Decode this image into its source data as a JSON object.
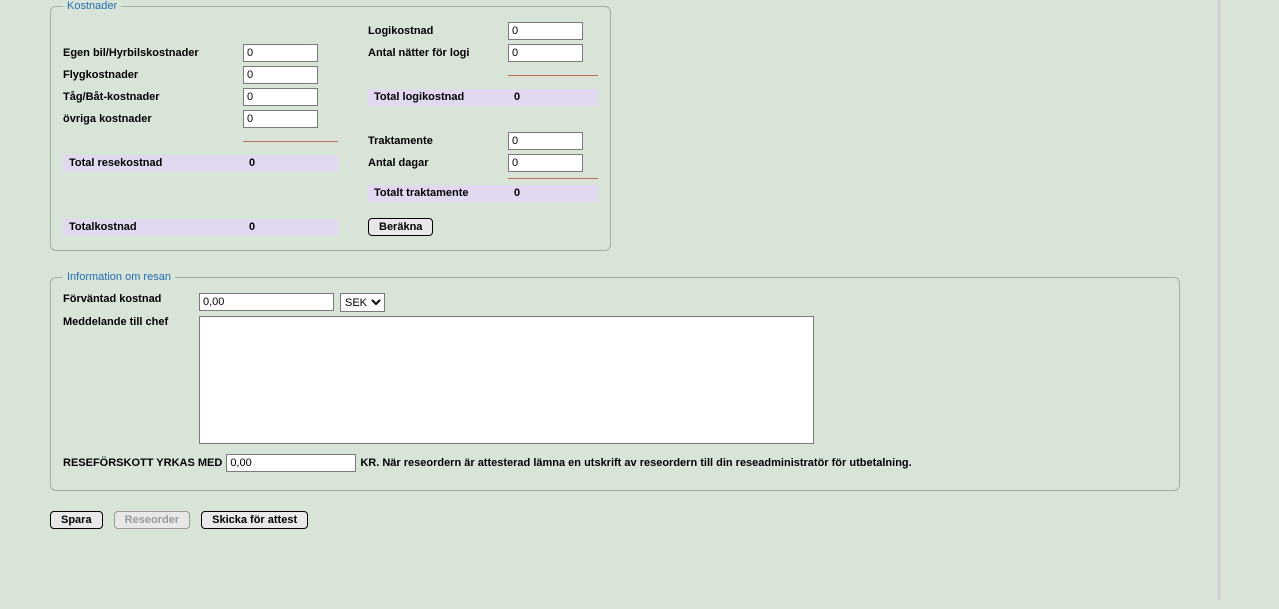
{
  "kostnader": {
    "legend": "Kostnader",
    "labels": {
      "egen_bil": "Egen bil/Hyrbilskostnader",
      "flyg": "Flygkostnader",
      "tag_bat": "Tåg/Båt-kostnader",
      "ovriga": "övriga kostnader",
      "total_rese": "Total resekostnad",
      "logi": "Logikostnad",
      "antal_natter": "Antal nätter för logi",
      "total_logi": "Total logikostnad",
      "traktamente": "Traktamente",
      "antal_dagar": "Antal dagar",
      "totalt_trakt": "Totalt traktamente",
      "totalkostnad": "Totalkostnad"
    },
    "values": {
      "egen_bil": "0",
      "flyg": "0",
      "tag_bat": "0",
      "ovriga": "0",
      "total_rese": "0",
      "logi": "0",
      "antal_natter": "0",
      "total_logi": "0",
      "traktamente": "0",
      "antal_dagar": "0",
      "totalt_trakt": "0",
      "totalkostnad": "0"
    },
    "berakna_label": "Beräkna"
  },
  "info": {
    "legend": "Information om resan",
    "labels": {
      "forvantad": "Förväntad kostnad",
      "meddelande": "Meddelande till chef",
      "reseforskott_prefix": "RESEFÖRSKOTT YRKAS MED",
      "reseforskott_suffix": "KR. När reseordern är attesterad lämna en utskrift av reseordern till din reseadministratör för utbetalning."
    },
    "values": {
      "forvantad": "0,00",
      "currency": "SEK",
      "meddelande": "",
      "reseforskott": "0,00"
    }
  },
  "buttons": {
    "spara": "Spara",
    "reseorder": "Reseorder",
    "skicka": "Skicka för attest"
  }
}
